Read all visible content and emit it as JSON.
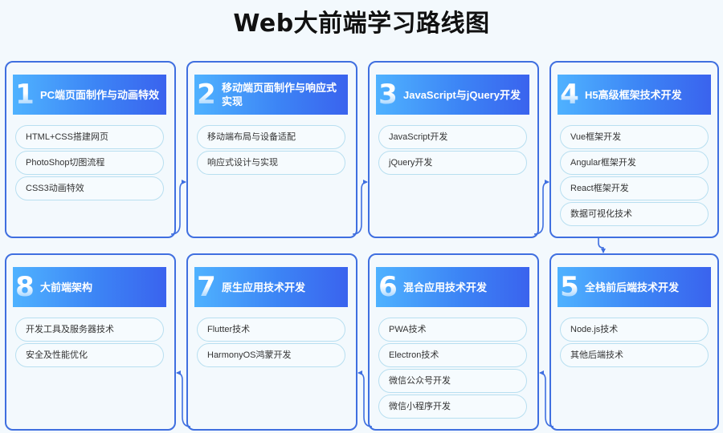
{
  "title": "Web大前端学习路线图",
  "stages": [
    {
      "number": "1",
      "title": "PC端页面制作与动画特效",
      "items": [
        "HTML+CSS搭建网页",
        "PhotoShop切图流程",
        "CSS3动画特效"
      ]
    },
    {
      "number": "2",
      "title": "移动端页面制作与响应式实现",
      "items": [
        "移动端布局与设备适配",
        "响应式设计与实现"
      ]
    },
    {
      "number": "3",
      "title": "JavaScript与jQuery开发",
      "items": [
        "JavaScript开发",
        "jQuery开发"
      ]
    },
    {
      "number": "4",
      "title": "H5高级框架技术开发",
      "items": [
        "Vue框架开发",
        "Angular框架开发",
        "React框架开发",
        "数据可视化技术"
      ]
    },
    {
      "number": "5",
      "title": "全栈前后端技术开发",
      "items": [
        "Node.js技术",
        "其他后端技术"
      ]
    },
    {
      "number": "6",
      "title": "混合应用技术开发",
      "items": [
        "PWA技术",
        "Electron技术",
        "微信公众号开发",
        "微信小程序开发"
      ]
    },
    {
      "number": "7",
      "title": "原生应用技术开发",
      "items": [
        "Flutter技术",
        "HarmonyOS鸿蒙开发"
      ]
    },
    {
      "number": "8",
      "title": "大前端架构",
      "items": [
        "开发工具及服务器技术",
        "安全及性能优化"
      ]
    }
  ],
  "colors": {
    "border": "#3f6fe0",
    "header_start": "#4fb2ff",
    "header_end": "#3a63ee",
    "pill_border": "#b8dff0"
  }
}
